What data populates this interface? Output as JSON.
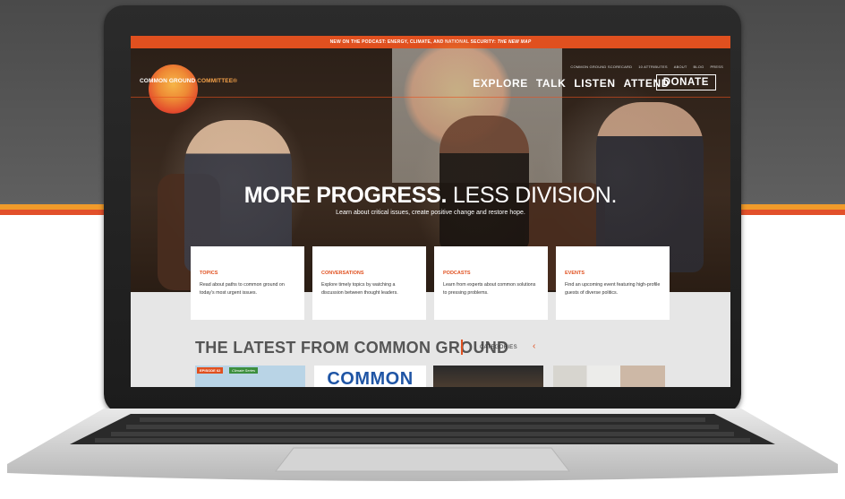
{
  "announcement": {
    "text": "NEW ON THE PODCAST: ENERGY, CLIMATE, AND NATIONAL SECURITY:",
    "highlight": "THE NEW MAP"
  },
  "logo": {
    "part1": "COMMON GROUND",
    "part2": "COMMITTEE",
    "mark": "®"
  },
  "top_links": [
    "COMMON GROUND SCORECARD",
    "10 ATTRIBUTES",
    "ABOUT",
    "BLOG",
    "PRESS"
  ],
  "nav": [
    "EXPLORE",
    "TALK",
    "LISTEN",
    "ATTEND"
  ],
  "donate_label": "DONATE",
  "hero": {
    "headline_bold": "MORE PROGRESS.",
    "headline_light": "LESS DIVISION.",
    "subhead": "Learn about critical issues, create positive change and restore hope."
  },
  "cards": [
    {
      "title": "TOPICS",
      "text": "Read about paths to common ground on today's most urgent issues."
    },
    {
      "title": "CONVERSATIONS",
      "text": "Explore timely topics by watching a discussion between thought leaders."
    },
    {
      "title": "PODCASTS",
      "text": "Learn from experts about common solutions to pressing problems."
    },
    {
      "title": "EVENTS",
      "text": "Find an upcoming event featuring high-profile guests of diverse politics."
    }
  ],
  "latest": {
    "heading": "THE LATEST FROM COMMON GROUND",
    "categories_label": "CATEGORIES",
    "arrow": "‹"
  },
  "tiles": {
    "episode_badge": "EPISODE 62",
    "series_badge": "Climate Series",
    "logo_text": "COMMON"
  },
  "colors": {
    "accent": "#e0501f",
    "brand_blue": "#1f55a5"
  }
}
